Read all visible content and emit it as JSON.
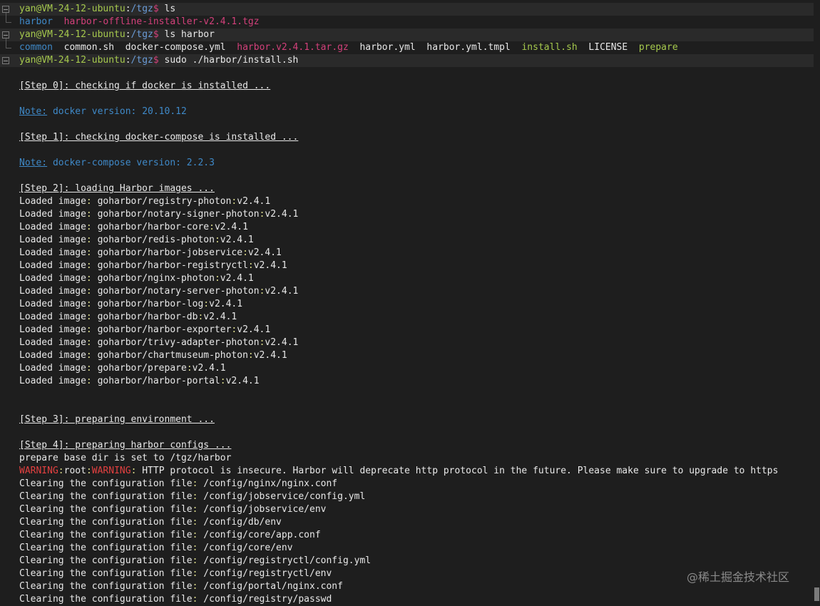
{
  "prompt": {
    "user_host": "yan@VM-24-12-ubuntu",
    "colon": ":",
    "cwd": "/tgz",
    "dollar": "$"
  },
  "commands": [
    {
      "text": " ls"
    },
    {
      "text": " ls harbor"
    },
    {
      "text": " sudo ./harbor/install.sh"
    }
  ],
  "ls_output": [
    {
      "name": "harbor",
      "kind": "dir"
    },
    {
      "name": "harbor-offline-installer-v2.4.1.tgz",
      "kind": "archive"
    }
  ],
  "ls_harbor_output": [
    {
      "name": "common",
      "kind": "dir"
    },
    {
      "name": "common.sh",
      "kind": "file"
    },
    {
      "name": "docker-compose.yml",
      "kind": "file"
    },
    {
      "name": "harbor.v2.4.1.tar.gz",
      "kind": "archive"
    },
    {
      "name": "harbor.yml",
      "kind": "file"
    },
    {
      "name": "harbor.yml.tmpl",
      "kind": "file"
    },
    {
      "name": "install.sh",
      "kind": "exec"
    },
    {
      "name": "LICENSE",
      "kind": "file"
    },
    {
      "name": "prepare",
      "kind": "exec"
    }
  ],
  "steps": {
    "step0": "[Step 0]: checking if docker is installed ...",
    "step1": "[Step 1]: checking docker-compose is installed ...",
    "step2": "[Step 2]: loading Harbor images ...",
    "step3": "[Step 3]: preparing environment ...",
    "step4": "[Step 4]: preparing harbor configs ..."
  },
  "notes": {
    "label": "Note:",
    "docker": " docker version: 20.10.12",
    "compose": " docker-compose version: 2.2.3"
  },
  "loaded_prefix": "Loaded image",
  "loaded_sep": ":",
  "loaded_images": [
    {
      "image": " goharbor/registry-photon",
      "tag": "v2.4.1"
    },
    {
      "image": " goharbor/notary-signer-photon",
      "tag": "v2.4.1"
    },
    {
      "image": " goharbor/harbor-core",
      "tag": "v2.4.1"
    },
    {
      "image": " goharbor/redis-photon",
      "tag": "v2.4.1"
    },
    {
      "image": " goharbor/harbor-jobservice",
      "tag": "v2.4.1"
    },
    {
      "image": " goharbor/harbor-registryctl",
      "tag": "v2.4.1"
    },
    {
      "image": " goharbor/nginx-photon",
      "tag": "v2.4.1"
    },
    {
      "image": " goharbor/notary-server-photon",
      "tag": "v2.4.1"
    },
    {
      "image": " goharbor/harbor-log",
      "tag": "v2.4.1"
    },
    {
      "image": " goharbor/harbor-db",
      "tag": "v2.4.1"
    },
    {
      "image": " goharbor/harbor-exporter",
      "tag": "v2.4.1"
    },
    {
      "image": " goharbor/trivy-adapter-photon",
      "tag": "v2.4.1"
    },
    {
      "image": " goharbor/chartmuseum-photon",
      "tag": "v2.4.1"
    },
    {
      "image": " goharbor/prepare",
      "tag": "v2.4.1"
    },
    {
      "image": " goharbor/harbor-portal",
      "tag": "v2.4.1"
    }
  ],
  "prepare_base": "prepare base dir is set to /tgz/harbor",
  "warning": {
    "w1": "WARNING",
    "colon1": ":",
    "root": "root",
    "colon2": ":",
    "w2": "WARNING",
    "colon3": ":",
    "message": " HTTP protocol is insecure. Harbor will deprecate http protocol in the future. Please make sure to upgrade to https"
  },
  "clearing_prefix": "Clearing the configuration file",
  "clearing_sep": ":",
  "clearing_files": [
    " /config/nginx/nginx.conf",
    " /config/jobservice/config.yml",
    " /config/jobservice/env",
    " /config/db/env",
    " /config/core/app.conf",
    " /config/core/env",
    " /config/registryctl/config.yml",
    " /config/registryctl/env",
    " /config/portal/nginx.conf",
    " /config/registry/passwd"
  ],
  "watermark": "@稀土掘金技术社区"
}
